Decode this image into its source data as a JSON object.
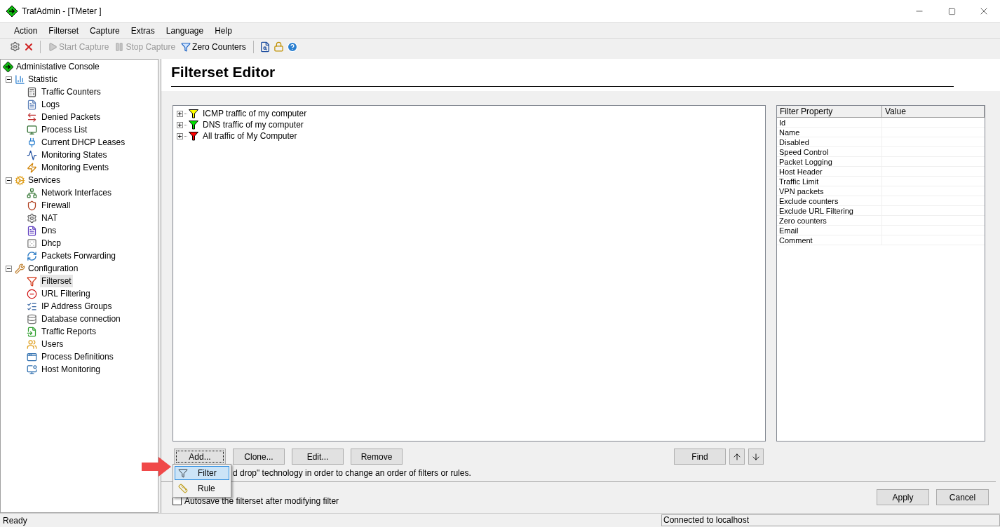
{
  "window": {
    "title": "TrafAdmin - [TMeter ]"
  },
  "menu": [
    "Action",
    "Filterset",
    "Capture",
    "Extras",
    "Language",
    "Help"
  ],
  "toolbar": [
    {
      "label": "Start Capture",
      "disabled": true
    },
    {
      "label": "Stop Capture",
      "disabled": true
    },
    {
      "label": "Zero Counters",
      "disabled": false
    }
  ],
  "sidebar": {
    "root": "Administative Console",
    "groups": [
      {
        "label": "Statistic",
        "expanded": true,
        "children": [
          {
            "label": "Traffic Counters",
            "selected": false
          },
          {
            "label": "Logs",
            "selected": false
          },
          {
            "label": "Denied Packets",
            "selected": false
          },
          {
            "label": "Process List",
            "selected": false
          },
          {
            "label": "Current DHCP Leases",
            "selected": false
          },
          {
            "label": "Monitoring States",
            "selected": false
          },
          {
            "label": "Monitoring Events",
            "selected": false
          }
        ]
      },
      {
        "label": "Services",
        "expanded": true,
        "children": [
          {
            "label": "Network Interfaces",
            "selected": false
          },
          {
            "label": "Firewall",
            "selected": false
          },
          {
            "label": "NAT",
            "selected": false
          },
          {
            "label": "Dns",
            "selected": false
          },
          {
            "label": "Dhcp",
            "selected": false
          },
          {
            "label": "Packets Forwarding",
            "selected": false
          }
        ]
      },
      {
        "label": "Configuration",
        "expanded": true,
        "children": [
          {
            "label": "Filterset",
            "selected": true
          },
          {
            "label": "URL Filtering",
            "selected": false
          },
          {
            "label": "IP Address Groups",
            "selected": false
          },
          {
            "label": "Database connection",
            "selected": false
          },
          {
            "label": "Traffic Reports",
            "selected": false
          },
          {
            "label": "Users",
            "selected": false
          },
          {
            "label": "Process Definitions",
            "selected": false
          },
          {
            "label": "Host Monitoring",
            "selected": false
          }
        ]
      }
    ]
  },
  "editor": {
    "title": "Filterset Editor",
    "filters": [
      {
        "label": "ICMP traffic of my computer",
        "color": "#ffff00"
      },
      {
        "label": "DNS traffic of my computer",
        "color": "#00e000"
      },
      {
        "label": "All traffic of My Computer",
        "color": "#ff0000"
      }
    ],
    "properties": {
      "columns": [
        "Filter Property",
        "Value"
      ],
      "rows": [
        "Id",
        "Name",
        "Disabled",
        "Speed Control",
        "Packet Logging",
        "Host Header",
        "Traffic Limit",
        "VPN packets",
        "Exclude counters",
        "Exclude URL Filtering",
        "Zero counters",
        "Email",
        "Comment"
      ]
    },
    "buttons": [
      "Add...",
      "Clone...",
      "Edit...",
      "Remove"
    ],
    "find_button": "Find",
    "hint": "d drop\" technology in order to change an order of filters or rules.",
    "add_menu": [
      {
        "label": "Filter",
        "selected": true
      },
      {
        "label": "Rule",
        "selected": false
      }
    ],
    "autosave": {
      "label": "Autosave the filterset after modifying filter",
      "checked": false
    },
    "footer_buttons": [
      "Apply",
      "Cancel"
    ]
  },
  "status_bar": [
    "Ready",
    "Connected to localhost"
  ]
}
